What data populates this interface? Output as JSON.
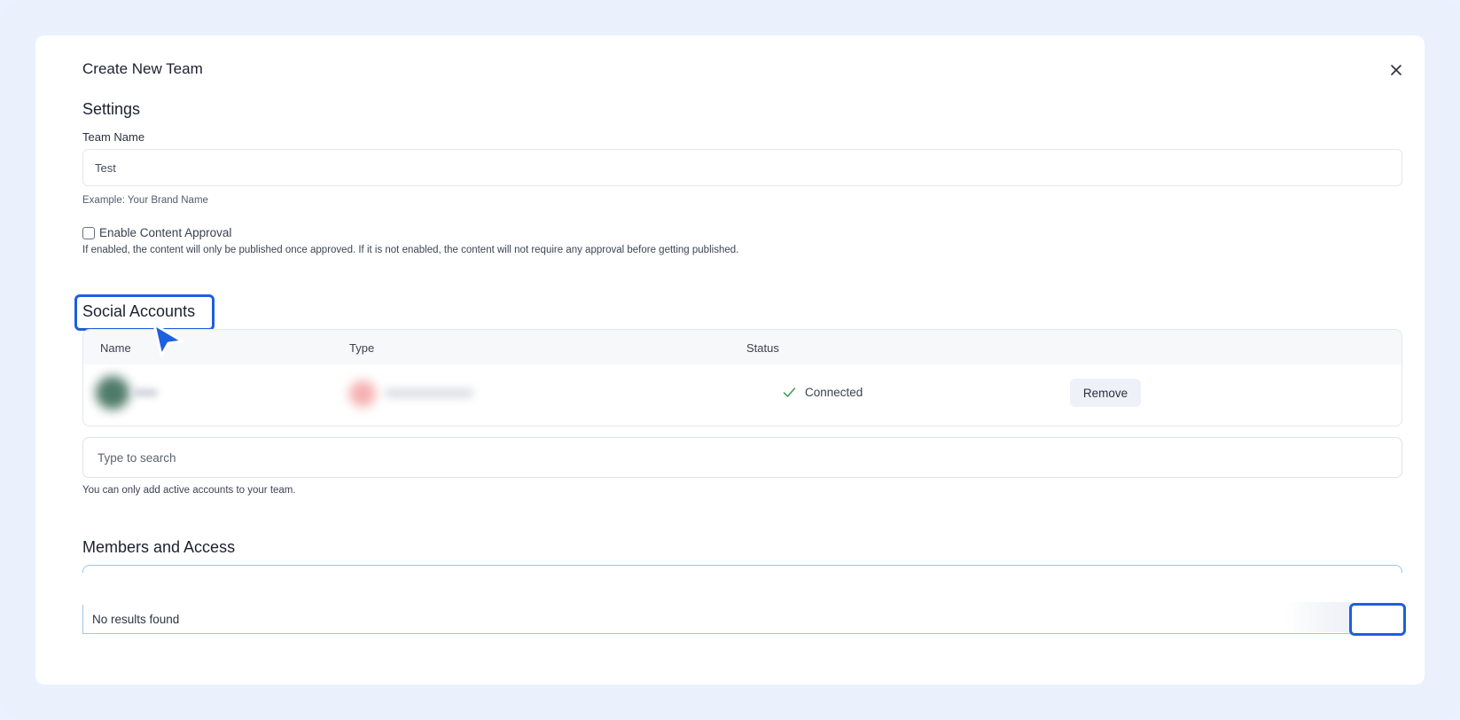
{
  "dialog": {
    "title": "Create New Team",
    "close_icon": "close-icon"
  },
  "settings": {
    "heading": "Settings",
    "team_name_label": "Team Name",
    "team_name_value": "Test",
    "team_name_hint": "Example: Your Brand Name",
    "approval_label": "Enable Content Approval",
    "approval_checked": false,
    "approval_description": "If enabled, the content will only be published once approved. If it is not enabled, the content will not require any approval before getting published."
  },
  "social_accounts": {
    "heading": "Social Accounts",
    "columns": [
      "Name",
      "Type",
      "Status"
    ],
    "rows": [
      {
        "status": "Connected",
        "status_icon": "check-icon",
        "action": "Remove"
      }
    ],
    "search_placeholder": "Type to search",
    "search_hint": "You can only add active accounts to your team."
  },
  "members": {
    "heading": "Members and Access",
    "dropdown_empty": "No results found"
  },
  "colors": {
    "accent": "#1c5fe0",
    "connected": "#3a9a55",
    "background": "#eaf1fd"
  }
}
